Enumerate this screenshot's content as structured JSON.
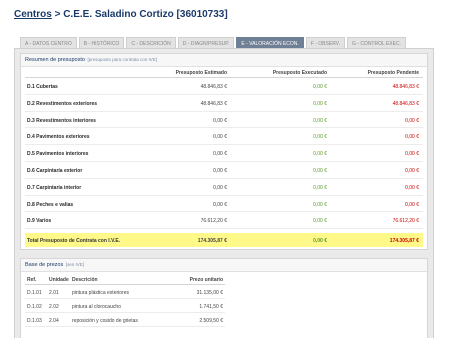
{
  "header": {
    "breadcrumb_link": "Centros",
    "separator": ">",
    "title": "C.E.E. Saladino Cortizo [36010733]"
  },
  "tabs": [
    {
      "label": "A - DATOS CENTRO",
      "active": false
    },
    {
      "label": "B - HISTÓRICO",
      "active": false
    },
    {
      "label": "C - DESCRICIÓN",
      "active": false
    },
    {
      "label": "D - DIAGN/PRESUP.",
      "active": false
    },
    {
      "label": "E - VALORACIÓN ECON.",
      "active": true
    },
    {
      "label": "F - OBSERV.",
      "active": false
    },
    {
      "label": "G - CONTROL EXEC.",
      "active": false
    }
  ],
  "budget": {
    "heading": "Resumen de presuposto",
    "note": "[presuposto para contrata con IVE]",
    "columns": {
      "estimated": "Presuposto Estimado",
      "executed": "Presuposto Executado",
      "pending": "Presuposto Pendente"
    },
    "rows": [
      {
        "label": "D.1 Cubertas",
        "estimated": "48.846,83 €",
        "executed": "0,00 €",
        "pending": "48.846,83 €"
      },
      {
        "label": "D.2 Revestimentos exteriores",
        "estimated": "48.846,83 €",
        "executed": "0,00 €",
        "pending": "48.846,83 €"
      },
      {
        "label": "D.3 Revestimentos interiores",
        "estimated": "0,00 €",
        "executed": "0,00 €",
        "pending": "0,00 €"
      },
      {
        "label": "D.4 Pavimentos exteriores",
        "estimated": "0,00 €",
        "executed": "0,00 €",
        "pending": "0,00 €"
      },
      {
        "label": "D.5 Pavimentos interiores",
        "estimated": "0,00 €",
        "executed": "0,00 €",
        "pending": "0,00 €"
      },
      {
        "label": "D.6 Carpintaría exterior",
        "estimated": "0,00 €",
        "executed": "0,00 €",
        "pending": "0,00 €"
      },
      {
        "label": "D.7 Carpintaría interior",
        "estimated": "0,00 €",
        "executed": "0,00 €",
        "pending": "0,00 €"
      },
      {
        "label": "D.8 Peches e valias",
        "estimated": "0,00 €",
        "executed": "0,00 €",
        "pending": "0,00 €"
      },
      {
        "label": "D.9 Varios",
        "estimated": "76.612,20 €",
        "executed": "0,00 €",
        "pending": "76.612,20 €"
      }
    ],
    "total": {
      "label": "Total Presuposto de Contrata con I.V.E.",
      "estimated": "174.305,87 €",
      "executed": "0,00 €",
      "pending": "174.305,87 €"
    }
  },
  "prices": {
    "heading": "Base de prezos",
    "note": "[sen IVE]",
    "columns": {
      "ref": "Ref.",
      "unit": "Unidade",
      "description": "Descrición",
      "price": "Prezo unitario"
    },
    "rows": [
      {
        "ref": "D.1.01",
        "unit": "2.01",
        "description": "pintura plástica exteriores",
        "price": "31.135,00 €"
      },
      {
        "ref": "D.1.02",
        "unit": "2.02",
        "description": "pintura al clorocaucho",
        "price": "1.741,50 €"
      },
      {
        "ref": "D.1.03",
        "unit": "2.04",
        "description": "reposición y cosido de grietas",
        "price": "2.509,50 €"
      }
    ]
  }
}
